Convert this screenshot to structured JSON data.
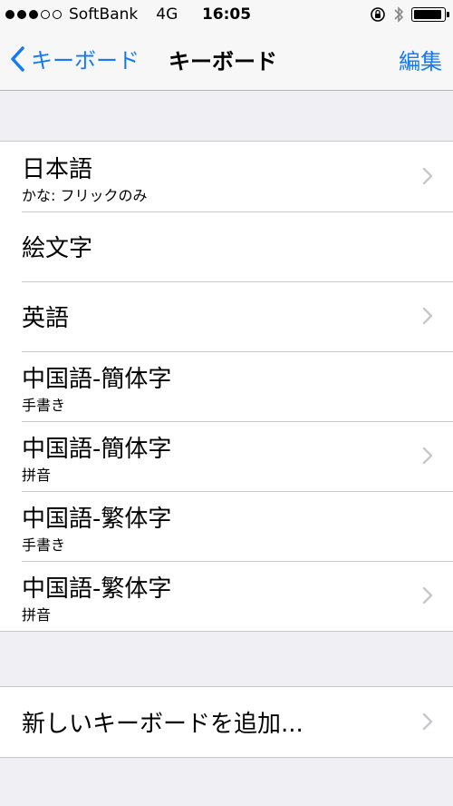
{
  "status_bar": {
    "carrier": "SoftBank",
    "network": "4G",
    "time": "16:05",
    "signal_full": 3,
    "signal_total": 5,
    "battery_level": 0.95,
    "icons": [
      "rotation-lock-icon",
      "bluetooth-icon",
      "battery-icon"
    ]
  },
  "nav": {
    "back_label": "キーボード",
    "title": "キーボード",
    "edit_label": "編集",
    "accent_color": "#1479f7"
  },
  "keyboards": [
    {
      "title": "日本語",
      "subtitle": "かな: フリックのみ",
      "chevron": true
    },
    {
      "title": "絵文字",
      "subtitle": "",
      "chevron": false
    },
    {
      "title": "英語",
      "subtitle": "",
      "chevron": true
    },
    {
      "title": "中国語-簡体字",
      "subtitle": "手書き",
      "chevron": false
    },
    {
      "title": "中国語-簡体字",
      "subtitle": "拼音",
      "chevron": true
    },
    {
      "title": "中国語-繁体字",
      "subtitle": "手書き",
      "chevron": false
    },
    {
      "title": "中国語-繁体字",
      "subtitle": "拼音",
      "chevron": true
    }
  ],
  "add_keyboard": {
    "label": "新しいキーボードを追加...",
    "chevron": true
  }
}
